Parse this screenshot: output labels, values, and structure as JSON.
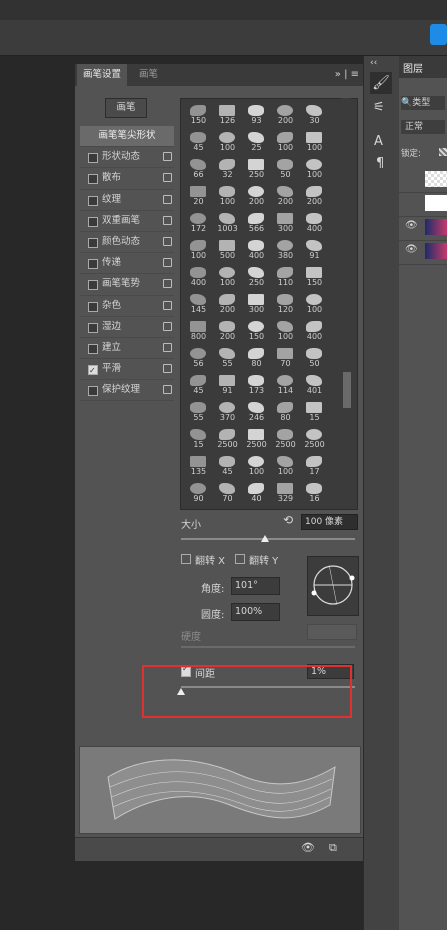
{
  "panel": {
    "tabs": [
      "画笔设置",
      "画笔"
    ],
    "menu": "» | ≡",
    "preset_button": "画笔",
    "tip_options": [
      {
        "label": "画笔笔尖形状",
        "checked": null,
        "lock": false
      },
      {
        "label": "形状动态",
        "checked": false,
        "lock": true
      },
      {
        "label": "散布",
        "checked": false,
        "lock": true
      },
      {
        "label": "纹理",
        "checked": false,
        "lock": true
      },
      {
        "label": "双重画笔",
        "checked": false,
        "lock": true
      },
      {
        "label": "颜色动态",
        "checked": false,
        "lock": true
      },
      {
        "label": "传递",
        "checked": false,
        "lock": true
      },
      {
        "label": "画笔笔势",
        "checked": false,
        "lock": true
      },
      {
        "label": "杂色",
        "checked": false,
        "lock": true
      },
      {
        "label": "湿边",
        "checked": false,
        "lock": true
      },
      {
        "label": "建立",
        "checked": false,
        "lock": true
      },
      {
        "label": "平滑",
        "checked": true,
        "lock": true
      },
      {
        "label": "保护纹理",
        "checked": false,
        "lock": true
      }
    ],
    "brush_sizes": [
      "150",
      "126",
      "93",
      "200",
      "30",
      "45",
      "100",
      "25",
      "100",
      "100",
      "66",
      "32",
      "250",
      "50",
      "100",
      "20",
      "100",
      "200",
      "200",
      "200",
      "172",
      "1003",
      "566",
      "300",
      "400",
      "100",
      "500",
      "400",
      "380",
      "91",
      "400",
      "100",
      "250",
      "110",
      "150",
      "145",
      "200",
      "300",
      "120",
      "100",
      "800",
      "200",
      "150",
      "100",
      "400",
      "56",
      "55",
      "80",
      "70",
      "50",
      "45",
      "91",
      "173",
      "114",
      "401",
      "55",
      "370",
      "246",
      "80",
      "15",
      "15",
      "2500",
      "2500",
      "2500",
      "2500",
      "135",
      "45",
      "100",
      "100",
      "17",
      "90",
      "70",
      "40",
      "329",
      "16"
    ],
    "size_label": "大小",
    "size_value": "100 像素",
    "flip_x": "翻转 X",
    "flip_y": "翻转 Y",
    "angle_label": "角度:",
    "angle_value": "101°",
    "roundness_label": "圆度:",
    "roundness_value": "100%",
    "hardness_label": "硬度",
    "spacing_label": "间距",
    "spacing_value": "1%",
    "spacing_checked": true
  },
  "layers_panel": {
    "tab": "图层",
    "kind_label": "类型",
    "blend_mode": "正常",
    "lock_label": "锁定:"
  },
  "colors": {
    "panel_bg": "#535353",
    "highlight_box": "#e03030",
    "app_icon": "#1e8ce6"
  }
}
